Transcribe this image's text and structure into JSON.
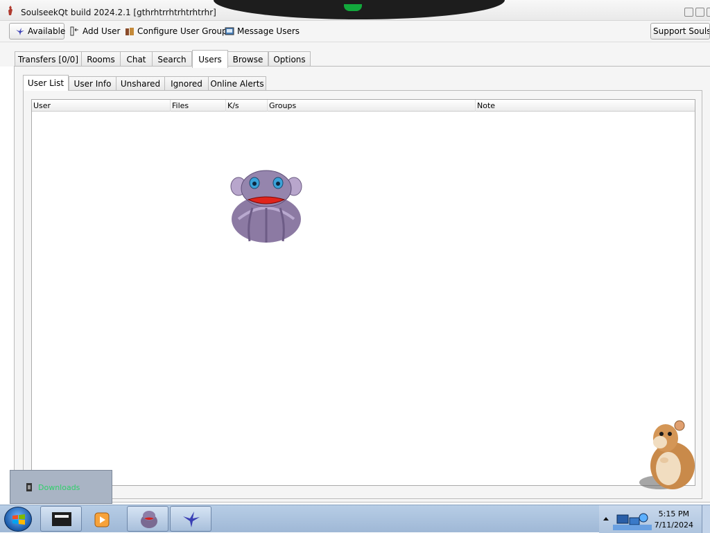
{
  "window": {
    "title": "SoulseekQt build 2024.2.1 [gthrhtrrhtrhtrhtrhr]"
  },
  "toolbar": {
    "status_label": "Available",
    "add_user_label": "Add User",
    "configure_groups_label": "Configure User Groups",
    "message_users_label": "Message Users",
    "support_label": "Support Soulseek"
  },
  "main_tabs": [
    "Transfers [0/0]",
    "Rooms",
    "Chat",
    "Search",
    "Users",
    "Browse",
    "Options"
  ],
  "active_main_tab": "Users",
  "sub_tabs": [
    "User List",
    "User Info",
    "Unshared",
    "Ignored",
    "Online Alerts"
  ],
  "active_sub_tab": "User List",
  "table": {
    "columns": [
      "User",
      "Files",
      "K/s",
      "Groups",
      "Note"
    ],
    "rows": []
  },
  "tray_popup": {
    "label": "Downloads"
  },
  "taskbar": {
    "time": "5:15 PM",
    "date": "7/11/2024"
  },
  "colors": {
    "tray_popup_text": "#2fd06a",
    "led": "#12a83c",
    "taskbar": "#a9c0dc"
  }
}
